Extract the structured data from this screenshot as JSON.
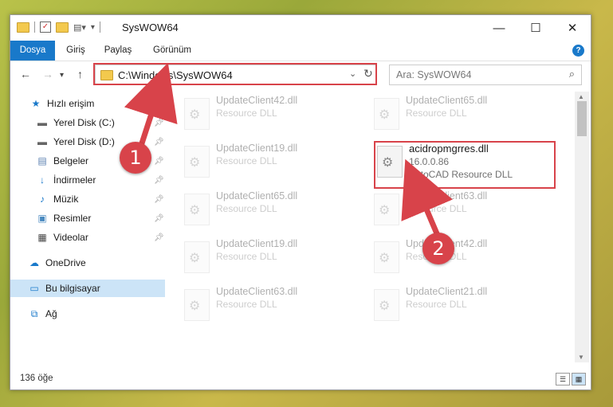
{
  "window": {
    "title": "SysWOW64",
    "controls": {
      "minimize": "—",
      "maximize": "☐",
      "close": "✕"
    }
  },
  "ribbon": {
    "tabs": [
      {
        "label": "Dosya",
        "active": true
      },
      {
        "label": "Giriş"
      },
      {
        "label": "Paylaş"
      },
      {
        "label": "Görünüm"
      }
    ],
    "help": "?"
  },
  "address": {
    "path": "C:\\Windows\\SysWOW64"
  },
  "search": {
    "placeholder": "Ara: SysWOW64"
  },
  "nav_pane": {
    "items": [
      {
        "label": "Hızlı erişim",
        "icon": "star-icon"
      },
      {
        "label": "Yerel Disk (C:)",
        "icon": "drive-icon",
        "pinned": true
      },
      {
        "label": "Yerel Disk (D:)",
        "icon": "drive-icon",
        "pinned": true
      },
      {
        "label": "Belgeler",
        "icon": "documents-icon",
        "pinned": true
      },
      {
        "label": "İndirmeler",
        "icon": "download-icon",
        "pinned": true
      },
      {
        "label": "Müzik",
        "icon": "music-icon",
        "pinned": true
      },
      {
        "label": "Resimler",
        "icon": "pictures-icon",
        "pinned": true
      },
      {
        "label": "Videolar",
        "icon": "videos-icon",
        "pinned": true
      },
      {
        "label": "OneDrive",
        "icon": "cloud-icon"
      },
      {
        "label": "Bu bilgisayar",
        "icon": "computer-icon",
        "selected": true
      },
      {
        "label": "Ağ",
        "icon": "network-icon"
      }
    ]
  },
  "files": [
    {
      "name": "UpdateClient42.dll",
      "sub": "Resource DLL"
    },
    {
      "name": "UpdateClient65.dll",
      "sub": "Resource DLL"
    },
    {
      "name": "UpdateClient19.dll",
      "sub": "Resource DLL"
    },
    {
      "name": "acidropmgrres.dll",
      "version": "16.0.0.86",
      "sub": "AutoCAD Resource DLL",
      "highlighted": true
    },
    {
      "name": "UpdateClient65.dll",
      "sub": "Resource DLL"
    },
    {
      "name": "UpdateClient63.dll",
      "sub": "Resource DLL"
    },
    {
      "name": "UpdateClient19.dll",
      "sub": "Resource DLL"
    },
    {
      "name": "UpdateClient42.dll",
      "sub": "Resource DLL"
    },
    {
      "name": "UpdateClient63.dll",
      "sub": "Resource DLL"
    },
    {
      "name": "UpdateClient21.dll",
      "sub": "Resource DLL"
    }
  ],
  "status": {
    "count": "136 öğe"
  },
  "callouts": [
    "1",
    "2"
  ],
  "colors": {
    "accent": "#1979ca",
    "highlight": "#d8434a",
    "selected": "#cce4f7"
  }
}
